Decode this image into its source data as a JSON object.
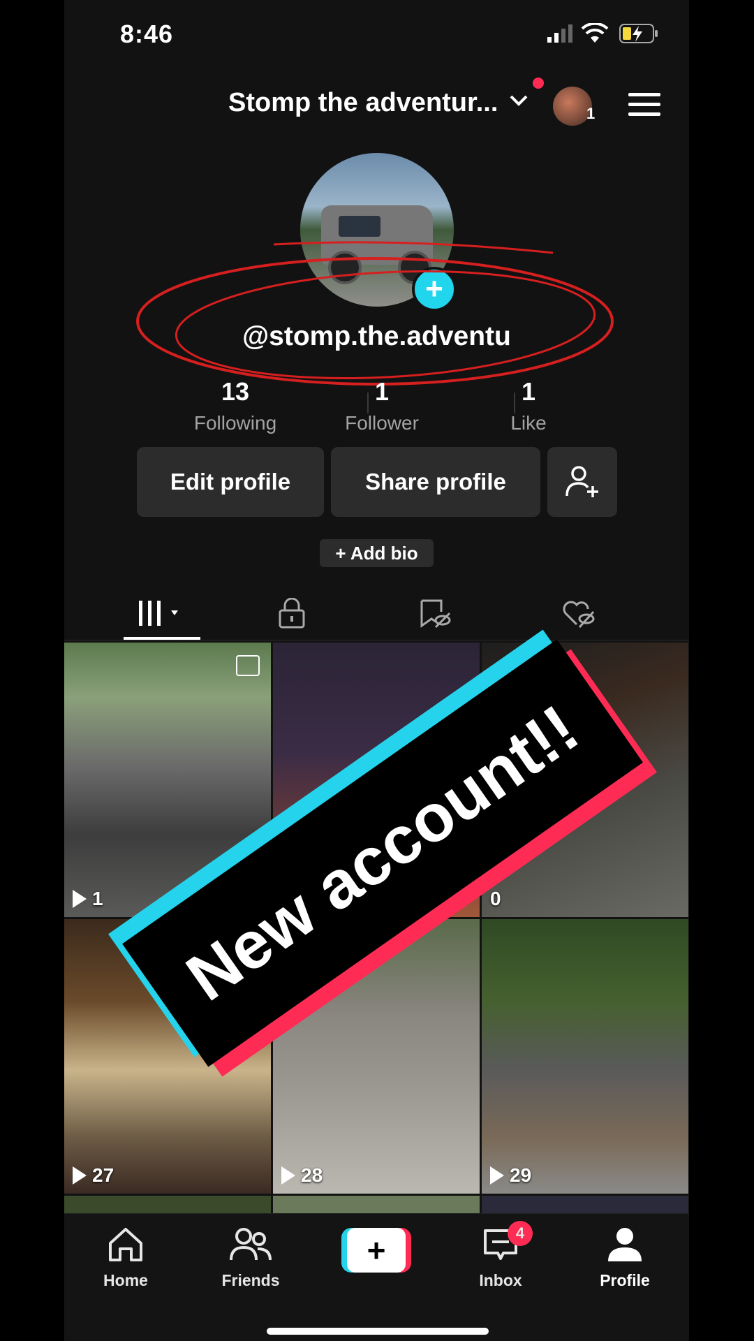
{
  "status_bar": {
    "time": "8:46"
  },
  "header": {
    "account_name": "Stomp the adventur...",
    "profile_switch_count": "1"
  },
  "profile": {
    "handle": "@stomp.the.adventu",
    "stats": [
      {
        "value": "13",
        "label": "Following"
      },
      {
        "value": "1",
        "label": "Follower"
      },
      {
        "value": "1",
        "label": "Like"
      }
    ],
    "edit_label": "Edit profile",
    "share_label": "Share profile",
    "add_bio_label": "+ Add bio"
  },
  "overlay": {
    "banner_text": "New account!!"
  },
  "videos": [
    {
      "views": "1"
    },
    {
      "views": ""
    },
    {
      "views": "0"
    },
    {
      "views": "27"
    },
    {
      "views": "28"
    },
    {
      "views": "29"
    }
  ],
  "nav": {
    "home": "Home",
    "friends": "Friends",
    "inbox": "Inbox",
    "inbox_badge": "4",
    "profile": "Profile"
  },
  "colors": {
    "accent_cyan": "#25d4ec",
    "accent_red": "#fe2c55",
    "background": "#121212"
  }
}
